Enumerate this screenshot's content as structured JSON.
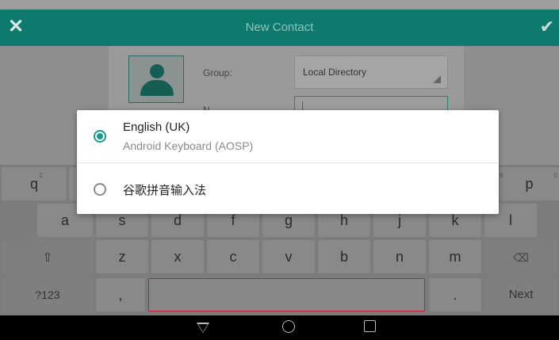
{
  "header": {
    "close_icon": "close-icon",
    "title": "New Contact",
    "confirm_icon": "check-icon",
    "bg": "#0e7a6e"
  },
  "form": {
    "group_label": "Group:",
    "group_value": "Local Directory",
    "name_label": "N",
    "name_value": "|"
  },
  "dialog": {
    "options": [
      {
        "title": "English (UK)",
        "subtitle": "Android Keyboard (AOSP)",
        "selected": true
      },
      {
        "title": "谷歌拼音输入法",
        "subtitle": "",
        "selected": false
      }
    ],
    "accent": "#1a9a8b"
  },
  "keyboard": {
    "row1": [
      {
        "label": "q",
        "hint": "1"
      },
      {
        "label": "p",
        "hint": "0"
      }
    ],
    "row1_hidden_hint": "9",
    "row2": [
      "a",
      "s",
      "d",
      "f",
      "g",
      "h",
      "j",
      "k",
      "l"
    ],
    "row3": [
      "z",
      "x",
      "c",
      "v",
      "b",
      "n",
      "m"
    ],
    "shift_icon": "shift-icon",
    "backspace_icon": "backspace-icon",
    "symbols_label": "?123",
    "comma_label": ",",
    "period_label": ".",
    "next_label": "Next"
  },
  "navbar": {
    "back_icon": "back-icon",
    "home_icon": "home-icon",
    "recents_icon": "recents-icon"
  }
}
